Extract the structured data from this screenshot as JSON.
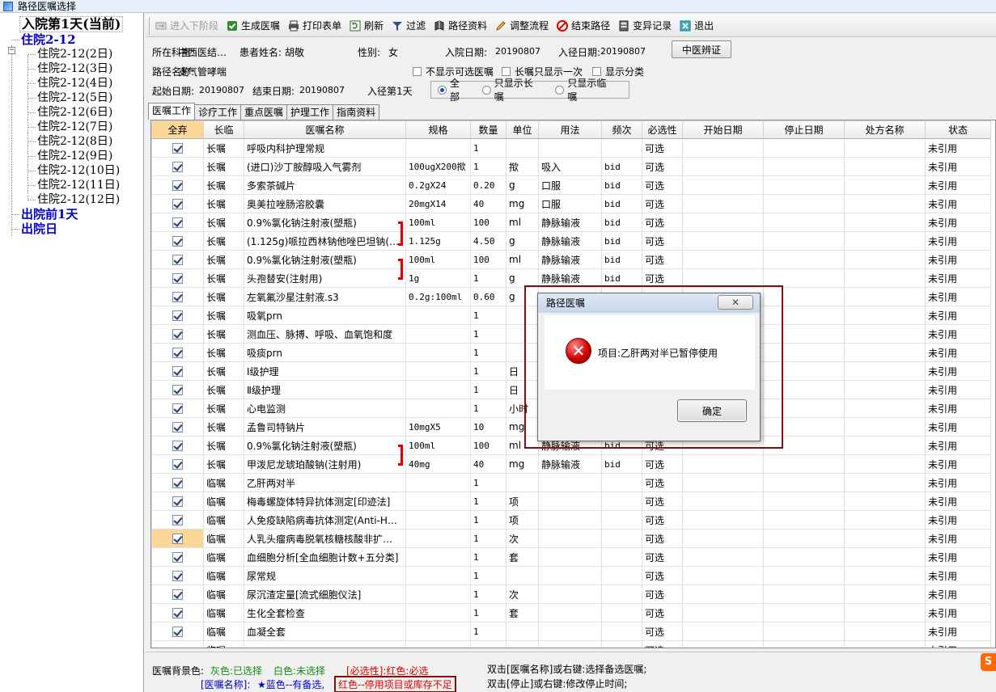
{
  "window": {
    "title": "路径医嘱选择"
  },
  "tree": {
    "root": "入院第1天(当前)",
    "group": "住院2-12",
    "children": [
      "住院2-12(2日)",
      "住院2-12(3日)",
      "住院2-12(4日)",
      "住院2-12(5日)",
      "住院2-12(6日)",
      "住院2-12(7日)",
      "住院2-12(8日)",
      "住院2-12(9日)",
      "住院2-12(10日)",
      "住院2-12(11日)",
      "住院2-12(12日)"
    ],
    "after": [
      "出院前1天",
      "出院日"
    ]
  },
  "toolbar": {
    "next_stage": "进入下阶段",
    "gen_order": "生成医嘱",
    "print_form": "打印表单",
    "refresh": "刷新",
    "filter": "过滤",
    "path_info": "路径资料",
    "adjust_flow": "调整流程",
    "end_path": "结束路径",
    "variance": "变异记录",
    "exit": "退出"
  },
  "patient": {
    "dept_label": "所在科室:",
    "dept": "中西医结…",
    "name_label": "患者姓名:",
    "name": "胡敬",
    "sex_label": "性别:",
    "sex": "女",
    "admit_label": "入院日期:",
    "admit_date": "20190807",
    "path_in_label": "入径日期:",
    "path_in_date": "20190807",
    "path_name_label": "路径名称:",
    "path_name": "支气管哮喘",
    "start_label": "起始日期:",
    "start_date": "20190807",
    "end_label": "结束日期:",
    "end_date": "20190807",
    "day": "入径第1天"
  },
  "options": {
    "tcm_button": "中医辨证",
    "no_optional": "不显示可选医嘱",
    "long_once": "长嘱只显示一次",
    "show_category": "显示分类",
    "radio_all": "全部",
    "radio_long": "只显示长嘱",
    "radio_temp": "只显示临嘱"
  },
  "tabs": [
    "医嘱工作",
    "诊疗工作",
    "重点医嘱",
    "护理工作",
    "指南资料"
  ],
  "grid": {
    "headers": [
      "全弃",
      "长临",
      "医嘱名称",
      "规格",
      "数量",
      "单位",
      "用法",
      "频次",
      "必选性",
      "开始日期",
      "停止日期",
      "处方名称",
      "状态"
    ],
    "rows": [
      [
        "长嘱",
        "呼吸内科护理常规",
        "",
        "1",
        "",
        "",
        "",
        "可选",
        "未引用"
      ],
      [
        "长嘱",
        "(进口)沙丁胺醇吸入气雾剂",
        "100ugX200揿",
        "1",
        "揿",
        "吸入",
        "bid",
        "可选",
        "未引用"
      ],
      [
        "长嘱",
        "多索茶碱片",
        "0.2gX24",
        "0.20",
        "g",
        "口服",
        "bid",
        "可选",
        "未引用"
      ],
      [
        "长嘱",
        "奥美拉唑肠溶胶囊",
        "20mgX14",
        "40",
        "mg",
        "口服",
        "bid",
        "可选",
        "未引用"
      ],
      [
        "长嘱",
        "0.9%氯化钠注射液(塑瓶)",
        "100ml",
        "100",
        "ml",
        "静脉输液",
        "bid",
        "可选",
        "未引用"
      ],
      [
        "长嘱",
        "(1.125g)哌拉西林钠他唑巴坦钠(…",
        "1.125g",
        "4.50",
        "g",
        "静脉输液",
        "bid",
        "可选",
        "未引用"
      ],
      [
        "长嘱",
        "0.9%氯化钠注射液(塑瓶)",
        "100ml",
        "100",
        "ml",
        "静脉输液",
        "bid",
        "可选",
        "未引用"
      ],
      [
        "长嘱",
        "头孢替安(注射用)",
        "1g",
        "1",
        "g",
        "静脉输液",
        "bid",
        "可选",
        "未引用"
      ],
      [
        "长嘱",
        "左氧氟沙星注射液.s3",
        "0.2g:100ml",
        "0.60",
        "g",
        "",
        "",
        "",
        "未引用"
      ],
      [
        "长嘱",
        "吸氧prn",
        "",
        "1",
        "",
        "",
        "",
        "",
        "未引用"
      ],
      [
        "长嘱",
        "测血压、脉搏、呼吸、血氧饱和度",
        "",
        "1",
        "",
        "",
        "",
        "",
        "未引用"
      ],
      [
        "长嘱",
        "吸痰prn",
        "",
        "1",
        "",
        "",
        "",
        "",
        "未引用"
      ],
      [
        "长嘱",
        "Ⅰ级护理",
        "",
        "1",
        "日",
        "",
        "",
        "",
        "未引用"
      ],
      [
        "长嘱",
        "Ⅱ级护理",
        "",
        "1",
        "日",
        "",
        "",
        "",
        "未引用"
      ],
      [
        "长嘱",
        "心电监测",
        "",
        "1",
        "小时",
        "",
        "",
        "",
        "未引用"
      ],
      [
        "长嘱",
        "孟鲁司特钠片",
        "10mgX5",
        "10",
        "mg",
        "",
        "",
        "",
        "未引用"
      ],
      [
        "长嘱",
        "0.9%氯化钠注射液(塑瓶)",
        "100ml",
        "100",
        "ml",
        "静脉输液",
        "bid",
        "可选",
        "未引用"
      ],
      [
        "长嘱",
        "甲泼尼龙琥珀酸钠(注射用)",
        "40mg",
        "40",
        "mg",
        "静脉输液",
        "bid",
        "可选",
        "未引用"
      ],
      [
        "临嘱",
        "乙肝两对半",
        "",
        "1",
        "",
        "",
        "",
        "可选",
        "未引用"
      ],
      [
        "临嘱",
        "梅毒螺旋体特异抗体测定[印迹法]",
        "",
        "1",
        "项",
        "",
        "",
        "可选",
        "未引用"
      ],
      [
        "临嘱",
        "人免疫缺陷病毒抗体测定(Anti-H…",
        "",
        "1",
        "项",
        "",
        "",
        "可选",
        "未引用"
      ],
      [
        "临嘱",
        "人乳头瘤病毒脱氧核糖核酸非扩…",
        "",
        "1",
        "次",
        "",
        "",
        "可选",
        "未引用"
      ],
      [
        "临嘱",
        "血细胞分析[全血细胞计数+五分类]",
        "",
        "1",
        "套",
        "",
        "",
        "可选",
        "未引用"
      ],
      [
        "临嘱",
        "尿常规",
        "",
        "1",
        "",
        "",
        "",
        "可选",
        "未引用"
      ],
      [
        "临嘱",
        "尿沉渣定量[流式细胞仪法]",
        "",
        "1",
        "次",
        "",
        "",
        "可选",
        "未引用"
      ],
      [
        "临嘱",
        "生化全套检查",
        "",
        "1",
        "套",
        "",
        "",
        "可选",
        "未引用"
      ],
      [
        "临嘱",
        "血凝全套",
        "",
        "1",
        "",
        "",
        "",
        "可选",
        "未引用"
      ],
      [
        "临嘱",
        "",
        "",
        "",
        "",
        "",
        "",
        "可选",
        "未引用"
      ]
    ]
  },
  "legend": {
    "bg_label": "医嘱背景色:",
    "gray": "灰色:已选择",
    "white": "白色:未选择",
    "required": "[必选性]:红色:必选",
    "name_label": "[医嘱名称]:",
    "star": "★蓝色--有备选,",
    "red_note": "红色--停用项目或库存不足",
    "hint1": "双击[医嘱名称]或右键:选择备选医嘱;",
    "hint2": "双击[停止]或右键:修改停止时间;"
  },
  "dialog": {
    "title": "路径医嘱",
    "message": "项目:乙肝两对半已暂停使用",
    "ok": "确定"
  },
  "colors": {
    "selected_row": "#fbd797",
    "alert_red": "#e00000",
    "frame": "#7b1010"
  }
}
